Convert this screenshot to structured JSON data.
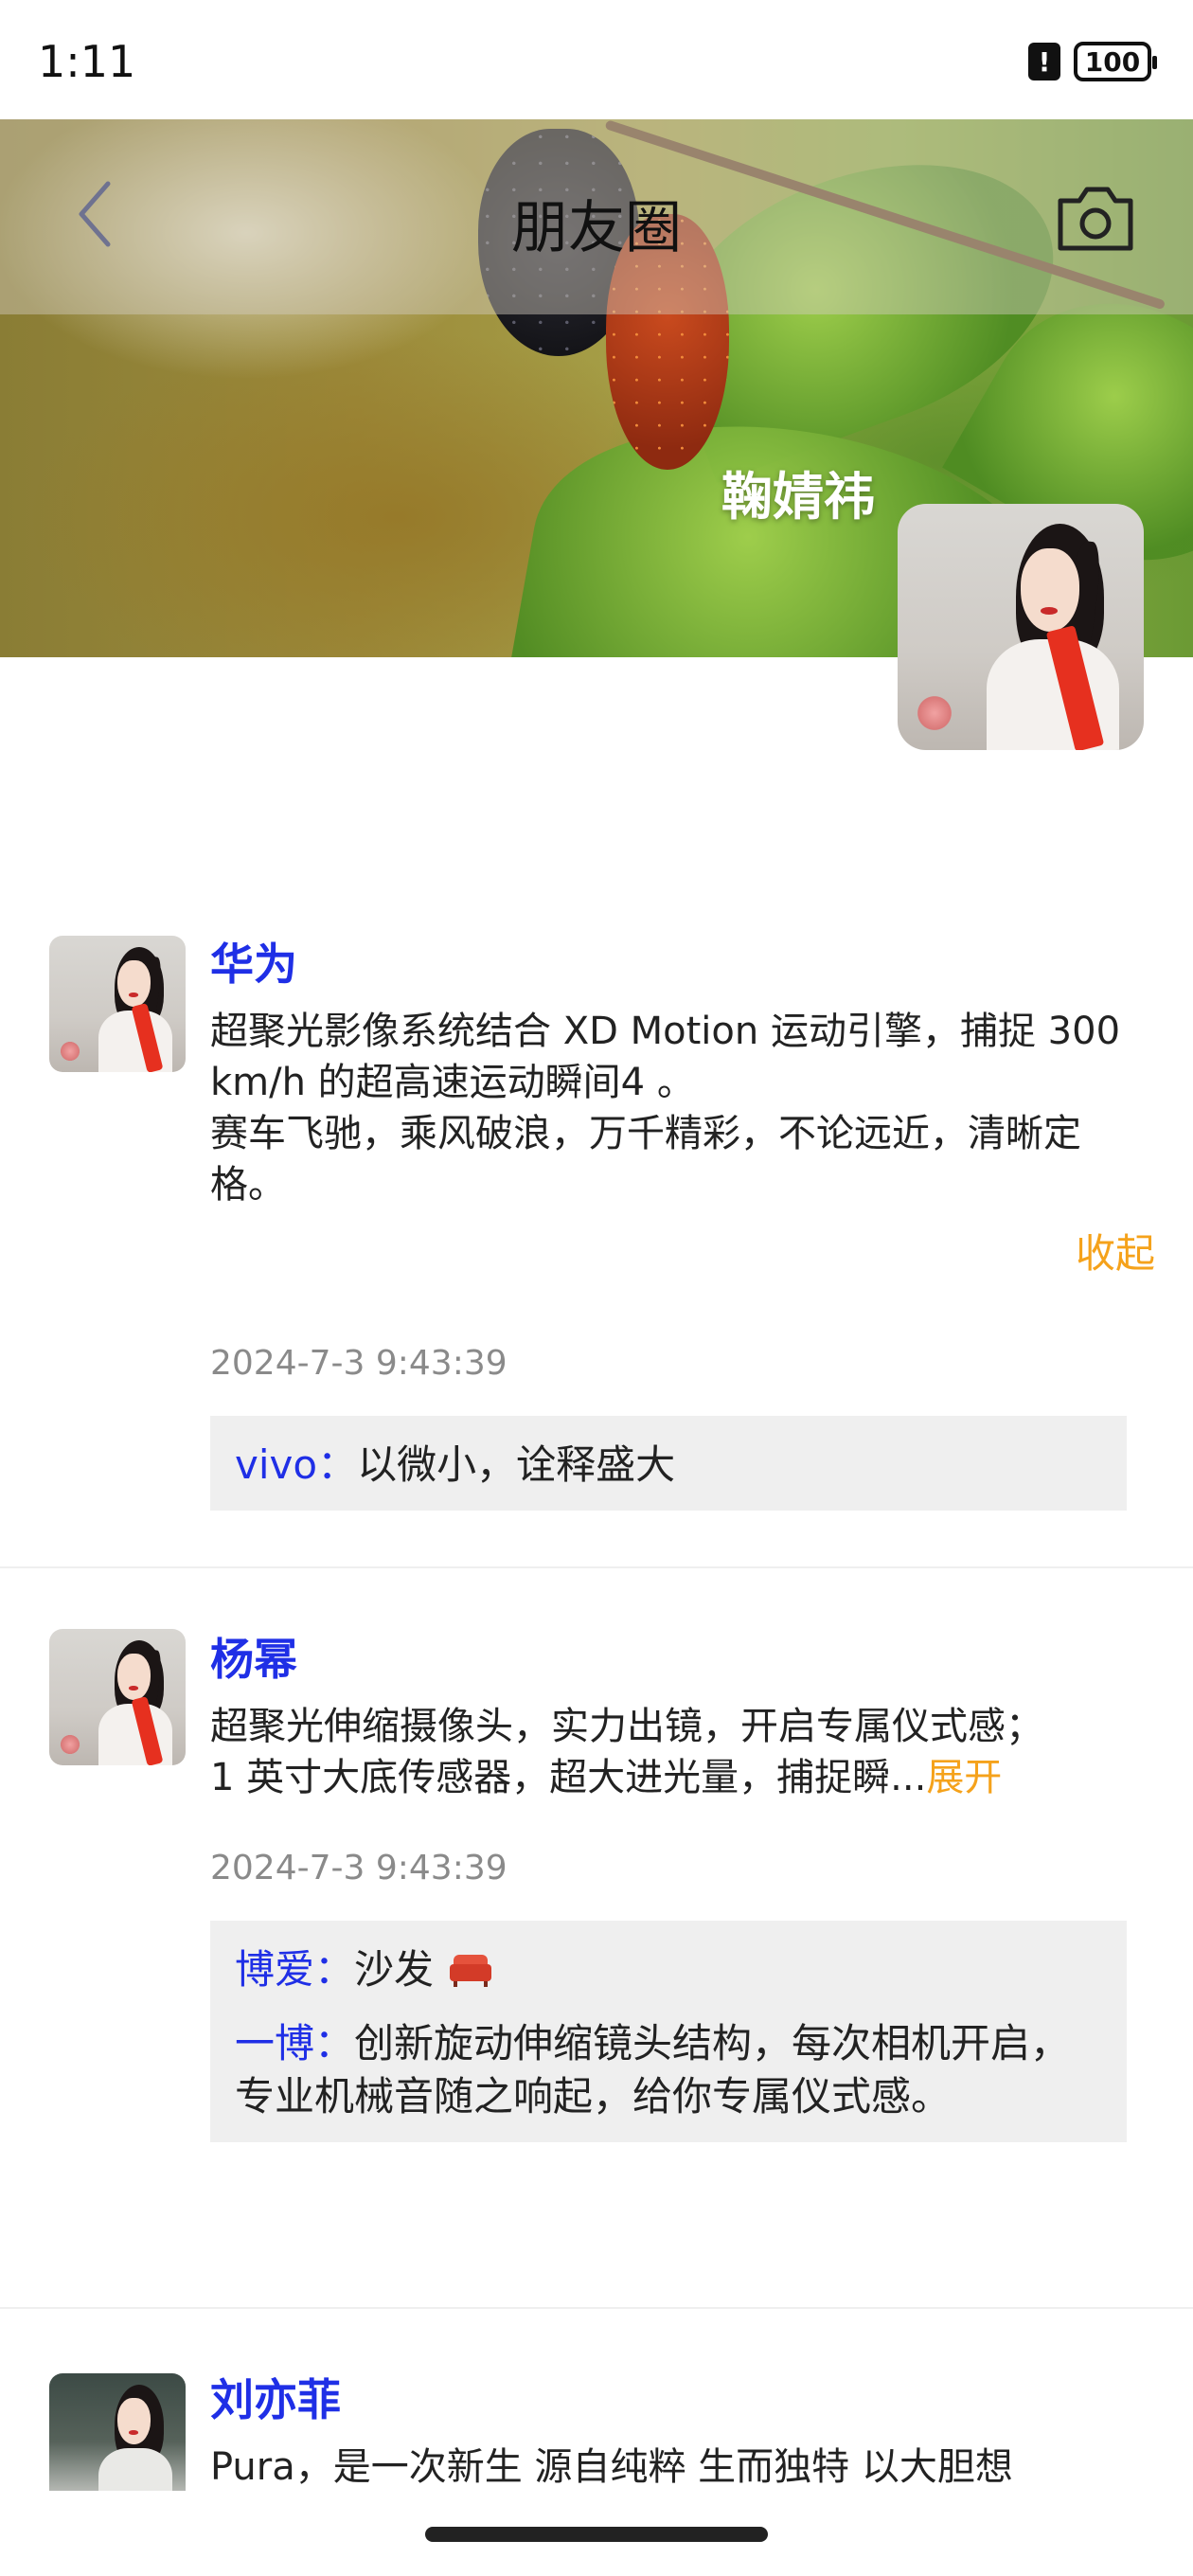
{
  "status_bar": {
    "time": "1:11",
    "alert": "!",
    "battery": "100"
  },
  "nav": {
    "title": "朋友圈"
  },
  "profile": {
    "username": "鞠婧祎"
  },
  "posts": [
    {
      "author": "华为",
      "text": "超聚光影像系统结合 XD Motion 运动引擎，捕捉 300 km/h 的超高速运动瞬间4 。\n赛车飞驰，乘风破浪，万千精彩，不论远近，清晰定格。",
      "toggle": "收起",
      "time": "2024-7-3 9:43:39",
      "comments": [
        {
          "name": "vivo：",
          "text": "以微小，诠释盛大"
        }
      ]
    },
    {
      "author": "杨幂",
      "text": "超聚光伸缩摄像头，实力出镜，开启专属仪式感；\n1 英寸大底传感器，超大进光量，捕捉瞬...",
      "toggle": "展开",
      "time": "2024-7-3 9:43:39",
      "comments": [
        {
          "name": "博爱：",
          "text": "沙发"
        },
        {
          "name": "一博：",
          "text": "创新旋动伸缩镜头结构，每次相机开启，专业机械音随之响起，给你专属仪式感。"
        }
      ]
    },
    {
      "author": "刘亦菲",
      "text": "Pura，是一次新生 源自纯粹 生而独特 以大胆想"
    }
  ],
  "icons": {
    "back": "chevron-left-icon",
    "camera": "camera-icon",
    "sofa": "sofa-emoji-icon"
  },
  "colors": {
    "author": "#1f2fe6",
    "toggle": "#f5a21b",
    "time": "#8a8a8a",
    "comment_bg": "#efefef"
  }
}
